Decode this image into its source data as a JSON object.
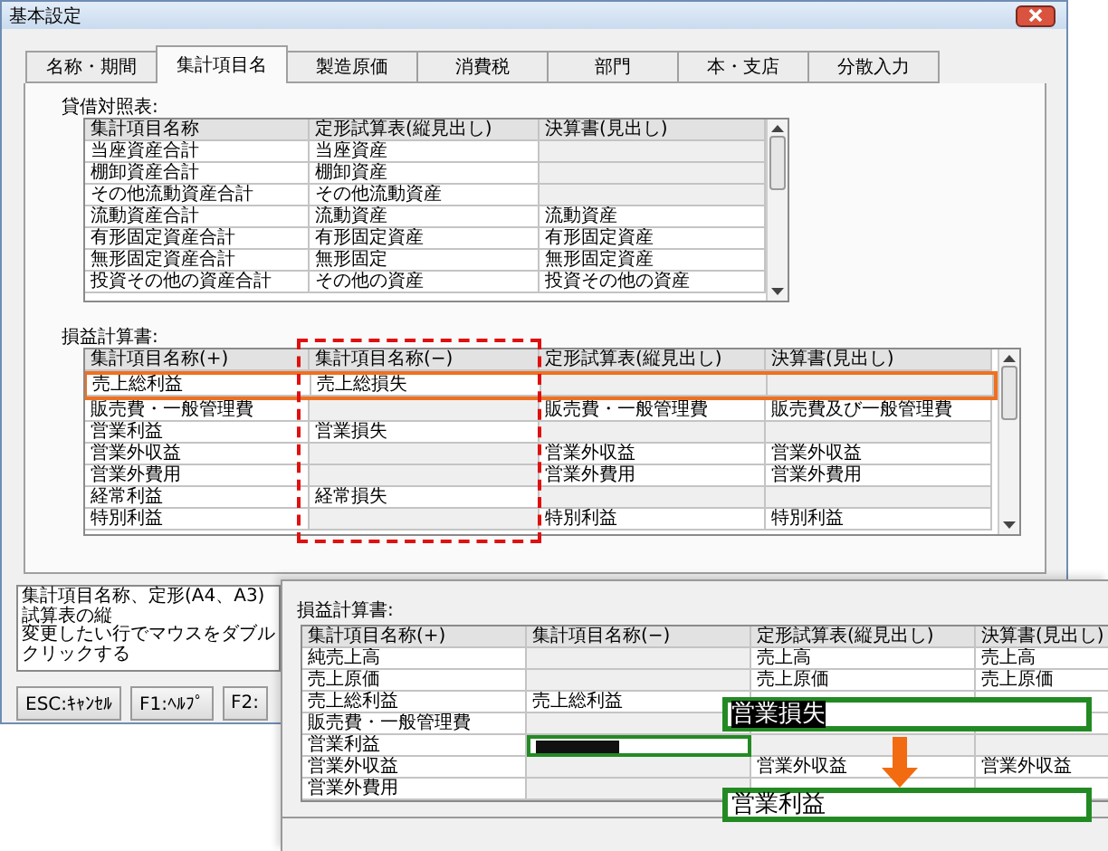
{
  "window": {
    "title": "基本設定"
  },
  "tabs": [
    {
      "label": "名称・期間",
      "selected": false
    },
    {
      "label": "集計項目名",
      "selected": true
    },
    {
      "label": "製造原価",
      "selected": false
    },
    {
      "label": "消費税",
      "selected": false
    },
    {
      "label": "部門",
      "selected": false
    },
    {
      "label": "本・支店",
      "selected": false
    },
    {
      "label": "分散入力",
      "selected": false
    }
  ],
  "balance_sheet": {
    "label": "貸借対照表:",
    "columns": [
      {
        "label": "集計項目名称"
      },
      {
        "label": "定形試算表(縦見出し)"
      },
      {
        "label": "決算書(見出し)"
      }
    ],
    "rows": [
      {
        "cells": [
          {
            "text": "当座資産合計",
            "disabled": false
          },
          {
            "text": "当座資産",
            "disabled": false
          },
          {
            "disabled": true
          }
        ]
      },
      {
        "cells": [
          {
            "text": "棚卸資産合計",
            "disabled": false
          },
          {
            "text": "棚卸資産",
            "disabled": false
          },
          {
            "disabled": true
          }
        ]
      },
      {
        "cells": [
          {
            "text": "その他流動資産合計",
            "disabled": false
          },
          {
            "text": "その他流動資産",
            "disabled": false
          },
          {
            "disabled": true
          }
        ]
      },
      {
        "cells": [
          {
            "text": "流動資産合計",
            "disabled": false
          },
          {
            "text": "流動資産",
            "disabled": false
          },
          {
            "text": "流動資産",
            "disabled": false
          }
        ]
      },
      {
        "cells": [
          {
            "text": "有形固定資産合計",
            "disabled": false
          },
          {
            "text": "有形固定資産",
            "disabled": false
          },
          {
            "text": "有形固定資産",
            "disabled": false
          }
        ]
      },
      {
        "cells": [
          {
            "text": "無形固定資産合計",
            "disabled": false
          },
          {
            "text": "無形固定",
            "disabled": false
          },
          {
            "text": "無形固定資産",
            "disabled": false
          }
        ]
      },
      {
        "cells": [
          {
            "text": "投資その他の資産合計",
            "disabled": false
          },
          {
            "text": "その他の資産",
            "disabled": false
          },
          {
            "text": "投資その他の資産",
            "disabled": false
          }
        ]
      }
    ]
  },
  "profit_loss": {
    "label": "損益計算書:",
    "columns": [
      {
        "label": "集計項目名称(+)",
        "highlighted": false
      },
      {
        "label": "集計項目名称(−)",
        "highlighted": true
      },
      {
        "label": "定形試算表(縦見出し)",
        "highlighted": false
      },
      {
        "label": "決算書(見出し)",
        "highlighted": false
      }
    ],
    "rows": [
      {
        "highlighted": true,
        "cells": [
          {
            "text": "売上総利益",
            "disabled": false
          },
          {
            "text": "売上総損失",
            "disabled": false
          },
          {
            "disabled": true
          },
          {
            "disabled": true
          }
        ]
      },
      {
        "highlighted": false,
        "cells": [
          {
            "text": "販売費・一般管理費",
            "disabled": false
          },
          {
            "disabled": true
          },
          {
            "text": "販売費・一般管理費",
            "disabled": false
          },
          {
            "text": "販売費及び一般管理費",
            "disabled": false
          }
        ]
      },
      {
        "highlighted": false,
        "cells": [
          {
            "text": "営業利益",
            "disabled": false
          },
          {
            "text": "営業損失",
            "disabled": false
          },
          {
            "disabled": true
          },
          {
            "disabled": true
          }
        ]
      },
      {
        "highlighted": false,
        "cells": [
          {
            "text": "営業外収益",
            "disabled": false
          },
          {
            "disabled": true
          },
          {
            "text": "営業外収益",
            "disabled": false
          },
          {
            "text": "営業外収益",
            "disabled": false
          }
        ]
      },
      {
        "highlighted": false,
        "cells": [
          {
            "text": "営業外費用",
            "disabled": false
          },
          {
            "disabled": true
          },
          {
            "text": "営業外費用",
            "disabled": false
          },
          {
            "text": "営業外費用",
            "disabled": false
          }
        ]
      },
      {
        "highlighted": false,
        "cells": [
          {
            "text": "経常利益",
            "disabled": false
          },
          {
            "text": "経常損失",
            "disabled": false
          },
          {
            "disabled": true
          },
          {
            "disabled": true
          }
        ]
      },
      {
        "highlighted": false,
        "cells": [
          {
            "text": "特別利益",
            "disabled": false
          },
          {
            "disabled": true
          },
          {
            "text": "特別利益",
            "disabled": false
          },
          {
            "text": "特別利益",
            "disabled": false
          }
        ]
      }
    ]
  },
  "hint": [
    "集計項目名称、定形(A4、A3)試算表の縦",
    "変更したい行でマウスをダブルクリックする"
  ],
  "buttons": [
    "ESC:ｷｬﾝｾﾙ",
    "F1:ﾍﾙﾌﾟ",
    "F2:"
  ],
  "inset": {
    "label": "損益計算書:",
    "columns": [
      "集計項目名称(+)",
      "集計項目名称(−)",
      "定形試算表(縦見出し)",
      "決算書(見出し)"
    ],
    "rows": [
      {
        "cells": [
          {
            "text": "純売上高",
            "disabled": false,
            "editing": false
          },
          {
            "disabled": true,
            "editing": false
          },
          {
            "text": "売上高",
            "disabled": false,
            "editing": false
          },
          {
            "text": "売上高",
            "disabled": false,
            "editing": false
          }
        ]
      },
      {
        "cells": [
          {
            "text": "売上原価",
            "disabled": false,
            "editing": false
          },
          {
            "disabled": true,
            "editing": false
          },
          {
            "text": "売上原価",
            "disabled": false,
            "editing": false
          },
          {
            "text": "売上原価",
            "disabled": false,
            "editing": false
          }
        ]
      },
      {
        "cells": [
          {
            "text": "売上総利益",
            "disabled": false,
            "editing": false
          },
          {
            "text": "売上総利益",
            "disabled": false,
            "editing": false
          },
          {},
          {}
        ]
      },
      {
        "cells": [
          {
            "text": "販売費・一般管理費",
            "disabled": false,
            "editing": false
          },
          {
            "disabled": true,
            "editing": false
          },
          {},
          {}
        ]
      },
      {
        "cells": [
          {
            "text": "営業利益",
            "disabled": false,
            "editing": false
          },
          {
            "disabled": false,
            "editing": true
          },
          {
            "disabled": true,
            "editing": false
          },
          {
            "disabled": true,
            "editing": false
          }
        ]
      },
      {
        "cells": [
          {
            "text": "営業外収益",
            "disabled": false,
            "editing": false
          },
          {
            "disabled": true,
            "editing": false
          },
          {
            "text": "営業外収益",
            "disabled": false,
            "editing": false
          },
          {
            "text": "営業外収益",
            "disabled": false,
            "editing": false
          }
        ]
      },
      {
        "cells": [
          {
            "text": "営業外費用",
            "disabled": false,
            "editing": false
          },
          {
            "disabled": true,
            "editing": false
          },
          {},
          {}
        ]
      }
    ],
    "callouts": [
      {
        "text": "営業損失",
        "inverted": true
      },
      {
        "text": "営業利益",
        "inverted": false
      }
    ]
  }
}
